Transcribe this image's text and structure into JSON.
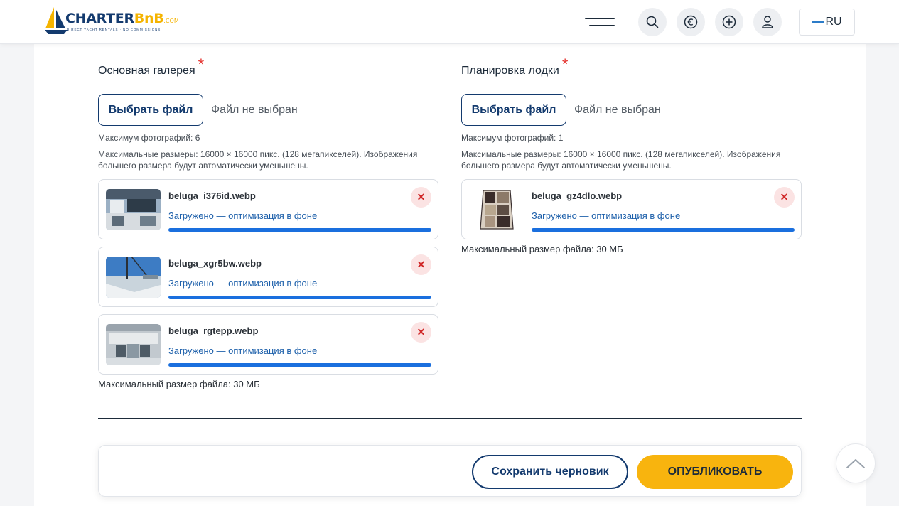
{
  "header": {
    "logo": {
      "brand_main": "CHARTER",
      "brand_accent": "BnB",
      "brand_suffix": ".COM",
      "tagline": "DIRECT YACHT RENTALS · NO COMMISSIONS"
    },
    "menu_icon": "hamburger-icon",
    "icons": [
      "search-icon",
      "euro-icon",
      "add-icon",
      "user-icon"
    ],
    "language": "RU"
  },
  "gallery": {
    "title": "Основная галерея",
    "required_mark": "*",
    "choose_label": "Выбрать файл",
    "no_file_label": "Файл не выбран",
    "max_photos": "Максимум фотографий: 6",
    "dimensions_hint": "Максимальные размеры: 16000 × 16000 пикс. (128 мегапикселей). Изображения большего размера будут автоматически уменьшены.",
    "files": [
      {
        "name": "beluga_i376id.webp",
        "status": "Загружено — оптимизация в фоне",
        "progress": 100
      },
      {
        "name": "beluga_xgr5bw.webp",
        "status": "Загружено — оптимизация в фоне",
        "progress": 100
      },
      {
        "name": "beluga_rgtepp.webp",
        "status": "Загружено — оптимизация в фоне",
        "progress": 100
      }
    ],
    "max_file_size": "Максимальный размер файла: 30 МБ"
  },
  "layout_plan": {
    "title": "Планировка лодки",
    "required_mark": "*",
    "choose_label": "Выбрать файл",
    "no_file_label": "Файл не выбран",
    "max_photos": "Максимум фотографий: 1",
    "dimensions_hint": "Максимальные размеры: 16000 × 16000 пикс. (128 мегапикселей). Изображения большего размера будут автоматически уменьшены.",
    "files": [
      {
        "name": "beluga_gz4dlo.webp",
        "status": "Загружено — оптимизация в фоне",
        "progress": 100
      }
    ],
    "max_file_size": "Максимальный размер файла: 30 МБ"
  },
  "actions": {
    "save_draft": "Сохранить черновик",
    "publish": "ОПУБЛИКОВАТЬ"
  },
  "colors": {
    "navy": "#133a6e",
    "accent_yellow": "#f8b40e",
    "progress_blue": "#1a6fde",
    "required_red": "#e53935"
  }
}
